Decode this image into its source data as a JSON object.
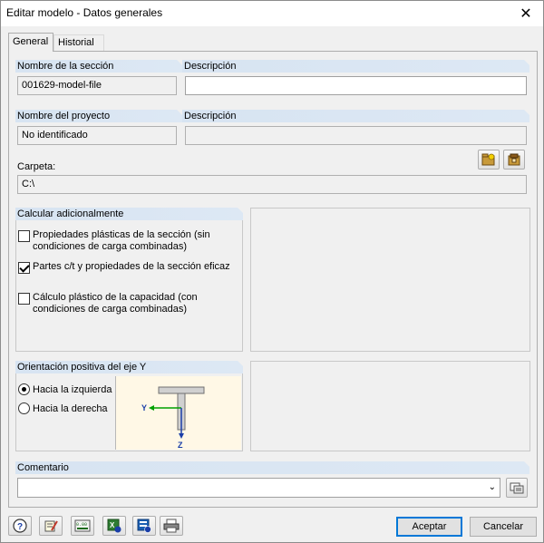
{
  "window": {
    "title": "Editar modelo - Datos generales"
  },
  "tabs": [
    {
      "label": "General",
      "active": true
    },
    {
      "label": "Historial",
      "active": false
    }
  ],
  "section": {
    "name_label": "Nombre de la sección",
    "name_value": "001629-model-file",
    "description_label": "Descripción",
    "description_value": ""
  },
  "project": {
    "name_label": "Nombre del proyecto",
    "name_value": "No identificado",
    "description_label": "Descripción",
    "description_value": "",
    "folder_label": "Carpeta:",
    "folder_value": "C:\\"
  },
  "calculate": {
    "header": "Calcular adicionalmente",
    "options": [
      {
        "label_line1": "Propiedades plásticas de la sección (sin",
        "label_line2": "condiciones de carga combinadas)",
        "checked": false
      },
      {
        "label_line1": "Partes c/t y propiedades de la sección eficaz",
        "label_line2": "",
        "checked": true
      },
      {
        "label_line1": "Cálculo plástico de la capacidad (con",
        "label_line2": "condiciones de carga combinadas)",
        "checked": false
      }
    ]
  },
  "orientation": {
    "header": "Orientación positiva del eje Y",
    "options": [
      {
        "label": "Hacia la izquierda",
        "selected": true
      },
      {
        "label": "Hacia la derecha",
        "selected": false
      }
    ],
    "diagram": {
      "y_label": "Y",
      "z_label": "Z"
    }
  },
  "comment": {
    "header": "Comentario",
    "value": ""
  },
  "buttons": {
    "accept": "Aceptar",
    "cancel": "Cancelar"
  },
  "colors": {
    "header_blue": "#d7e4f2",
    "diagram_bg": "#fff8e6",
    "arrow_green": "#00a000",
    "arrow_blue": "#1a3ea8"
  },
  "icons": {
    "folder_browse": "folder-open-icon",
    "folder_settings": "folder-settings-icon",
    "comment_browse": "comment-list-icon",
    "footer": [
      "help-icon",
      "edit-icon",
      "units-icon",
      "export-excel-icon",
      "export-data-icon",
      "print-icon"
    ]
  }
}
